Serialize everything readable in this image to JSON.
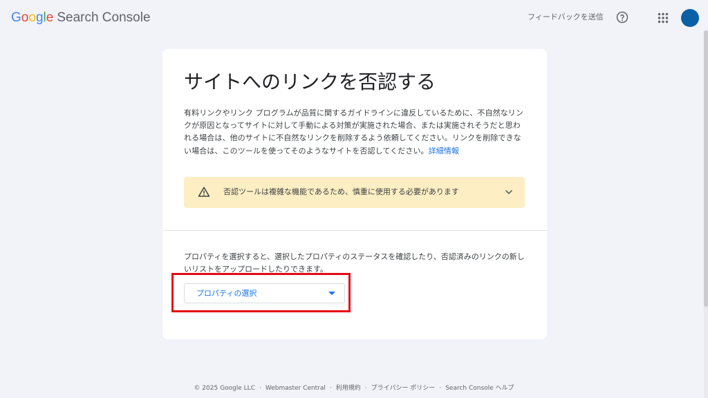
{
  "header": {
    "logo": {
      "g1": "G",
      "o1": "o",
      "o2": "o",
      "g2": "g",
      "l": "l",
      "e": "e",
      "product": "Search Console"
    },
    "feedback_label": "フィードバックを送信",
    "help_icon": "help-circle-icon",
    "apps_icon": "apps-grid-icon",
    "avatar_color": "#0b5fa5"
  },
  "card": {
    "title": "サイトへのリンクを否認する",
    "description": "有料リンクやリンク プログラムが品質に関するガイドラインに違反しているために、不自然なリンクが原因となってサイトに対して手動による対策が実施された場合、または実施されそうだと思われる場合は、他のサイトに不自然なリンクを削除するよう依頼してください。リンクを削除できない場合は、このツールを使ってそのようなサイトを否認してください。",
    "learn_more": "詳細情報",
    "warning": {
      "icon": "warning-triangle-icon",
      "text": "否認ツールは複雑な機能であるため、慎重に使用する必要があります",
      "expand_icon": "chevron-down-icon",
      "background": "#fdefc3"
    },
    "property_description": "プロパティを選択すると、選択したプロパティのステータスを確認したり、否認済みのリンクの新しいリストをアップロードしたりできます。",
    "property_select": {
      "label": "プロパティの選択",
      "highlight_color": "#e50914"
    }
  },
  "footer": {
    "copyright": "© 2025 Google LLC",
    "links": [
      "Webmaster Central",
      "利用規約",
      "プライバシー ポリシー",
      "Search Console ヘルプ"
    ],
    "separator": "·"
  }
}
